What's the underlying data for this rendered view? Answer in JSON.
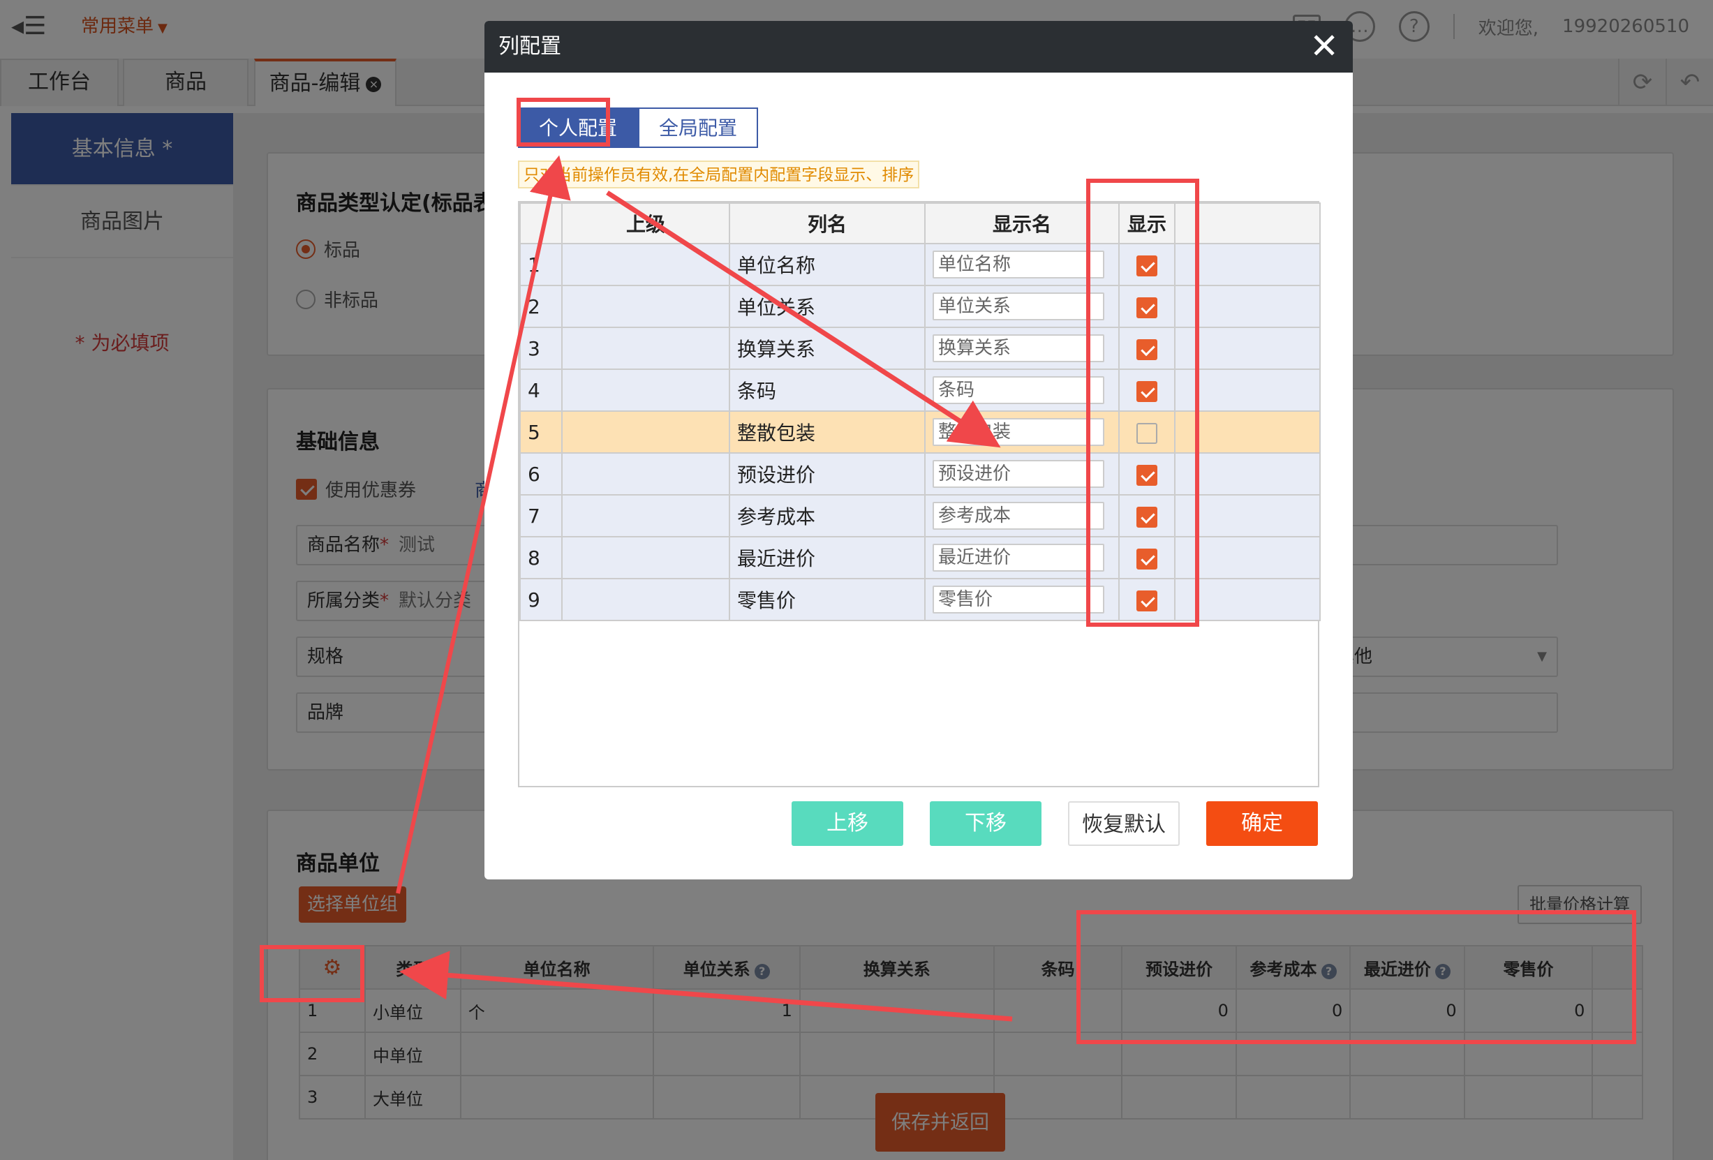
{
  "header": {
    "fav_label": "常用菜单",
    "welcome": "欢迎您,",
    "user": "19920260510"
  },
  "tabs": [
    {
      "label": "工作台"
    },
    {
      "label": "商品"
    },
    {
      "label": "商品-编辑"
    }
  ],
  "sidebar": {
    "items": [
      {
        "label": "基本信息 *"
      },
      {
        "label": "商品图片"
      }
    ],
    "required_note": "* 为必填项"
  },
  "section1": {
    "title": "商品类型认定(标品表",
    "options": [
      {
        "label": "标品",
        "selected": true
      },
      {
        "label": "非标品",
        "selected": false
      }
    ]
  },
  "section2": {
    "title": "基础信息",
    "coupon_label": "使用优惠券",
    "coupon_checked": true,
    "coupon_suffix": "商",
    "fields": [
      {
        "label": "商品名称",
        "required": true,
        "value": "测试"
      },
      {
        "label": "所属分类",
        "required": true,
        "value": "默认分类"
      },
      {
        "label": "规格",
        "required": false,
        "value": ""
      },
      {
        "label": "品牌",
        "required": false,
        "value": ""
      }
    ],
    "right_select": "其他"
  },
  "section3": {
    "title": "商品单位",
    "choose_btn": "选择单位组",
    "batch_btn": "批量价格计算",
    "save_btn": "保存并返回",
    "columns": [
      "类型",
      "单位名称",
      "单位关系",
      "换算关系",
      "条码",
      "预设进价",
      "参考成本",
      "最近进价",
      "零售价"
    ],
    "rows": [
      {
        "no": "1",
        "type": "小单位",
        "name": "个",
        "relation": "1",
        "convert": "",
        "barcode": "",
        "preset": "0",
        "ref": "0",
        "recent": "0",
        "retail": "0"
      },
      {
        "no": "2",
        "type": "中单位",
        "name": "",
        "relation": "",
        "convert": "",
        "barcode": "",
        "preset": "",
        "ref": "",
        "recent": "",
        "retail": ""
      },
      {
        "no": "3",
        "type": "大单位",
        "name": "",
        "relation": "",
        "convert": "",
        "barcode": "",
        "preset": "",
        "ref": "",
        "recent": "",
        "retail": ""
      }
    ]
  },
  "dialog": {
    "title": "列配置",
    "tabs": [
      {
        "label": "个人配置",
        "active": true
      },
      {
        "label": "全局配置",
        "active": false
      }
    ],
    "tip": "只对当前操作员有效,在全局配置内配置字段显示、排序",
    "columns": [
      "上级",
      "列名",
      "显示名",
      "显示"
    ],
    "rows": [
      {
        "no": "1",
        "name": "单位名称",
        "display": "单位名称",
        "show": true
      },
      {
        "no": "2",
        "name": "单位关系",
        "display": "单位关系",
        "show": true
      },
      {
        "no": "3",
        "name": "换算关系",
        "display": "换算关系",
        "show": true
      },
      {
        "no": "4",
        "name": "条码",
        "display": "条码",
        "show": true
      },
      {
        "no": "5",
        "name": "整散包装",
        "display": "整散包装",
        "show": false
      },
      {
        "no": "6",
        "name": "预设进价",
        "display": "预设进价",
        "show": true
      },
      {
        "no": "7",
        "name": "参考成本",
        "display": "参考成本",
        "show": true
      },
      {
        "no": "8",
        "name": "最近进价",
        "display": "最近进价",
        "show": true
      },
      {
        "no": "9",
        "name": "零售价",
        "display": "零售价",
        "show": true
      }
    ],
    "buttons": {
      "up": "上移",
      "down": "下移",
      "reset": "恢复默认",
      "ok": "确定"
    }
  },
  "colors": {
    "accent": "#e85d2b",
    "primary": "#3c5aa6",
    "annotation": "#f0474a"
  }
}
